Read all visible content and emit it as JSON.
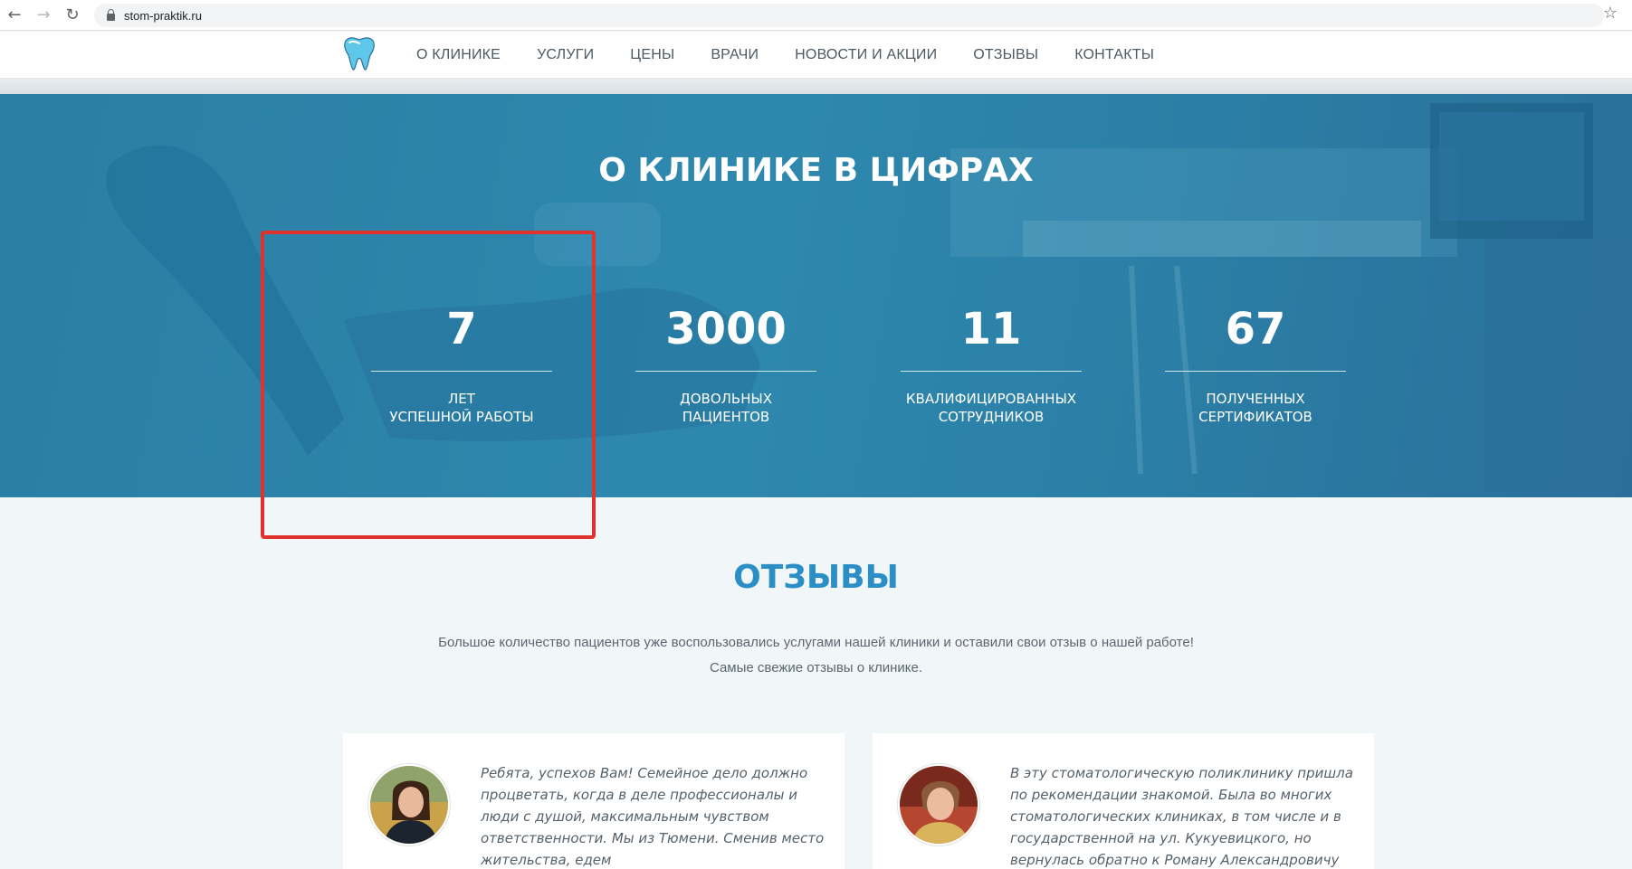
{
  "browser": {
    "url": "stom-praktik.ru"
  },
  "header": {
    "menu": [
      "О КЛИНИКЕ",
      "УСЛУГИ",
      "ЦЕНЫ",
      "ВРАЧИ",
      "НОВОСТИ И АКЦИИ",
      "ОТЗЫВЫ",
      "КОНТАКТЫ"
    ]
  },
  "stats": {
    "title_bold": "О КЛИНИКЕ",
    "title_rest": " В ЦИФРАХ",
    "items": [
      {
        "number": "7",
        "line1": "ЛЕТ",
        "line2": "УСПЕШНОЙ РАБОТЫ"
      },
      {
        "number": "3000",
        "line1": "ДОВОЛЬНЫХ",
        "line2": "ПАЦИЕНТОВ"
      },
      {
        "number": "11",
        "line1": "КВАЛИФИЦИРОВАННЫХ",
        "line2": "СОТРУДНИКОВ"
      },
      {
        "number": "67",
        "line1": "ПОЛУЧЕННЫХ",
        "line2": "СЕРТИФИКАТОВ"
      }
    ]
  },
  "reviews": {
    "title": "ОТЗЫВЫ",
    "intro_line1": "Большое количество пациентов уже воспользовались услугами нашей клиники и оставили свои отзыв о нашей работе!",
    "intro_line2": "Самые свежие отзывы о клинике.",
    "cards": [
      {
        "text": "Ребята, успехов Вам! Семейное дело должно процветать, когда в деле профессионалы и люди с душой, максимальным чувством ответственности. Мы из Тюмени. Сменив место жительства, едем"
      },
      {
        "text": "В эту стоматологическую поликлинику пришла по рекомендации знакомой. Была во многих стоматологических клиниках, в том числе и в государственной на ул. Кукуевицкого, но вернулась обратно к Роману Александровичу Быкову. Роман"
      }
    ]
  },
  "colors": {
    "accent": "#2b8fc6",
    "hero": "#2e86ad",
    "highlight": "#e0332d"
  }
}
